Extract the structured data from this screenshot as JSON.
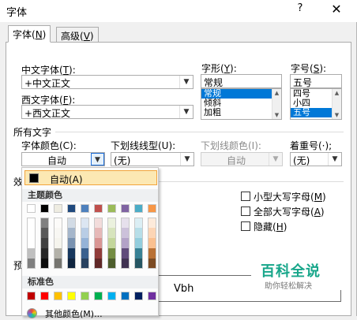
{
  "window": {
    "title": "字体",
    "help_label": "?",
    "close_label": "✕"
  },
  "tabs": [
    {
      "label": "字体(",
      "key": "N",
      "suffix": ")"
    },
    {
      "label": "高级(",
      "key": "V",
      "suffix": ")"
    }
  ],
  "font": {
    "chinese_label": "中文字体(",
    "chinese_key": "T",
    "chinese_suffix": "):",
    "chinese_value": "+中文正文",
    "western_label": "西文字体(",
    "western_key": "F",
    "western_suffix": "):",
    "western_value": "+西文正文",
    "style_label": "字形(",
    "style_key": "Y",
    "style_suffix": "):",
    "style_value": "常规",
    "style_options": [
      "常规",
      "倾斜",
      "加粗"
    ],
    "size_label": "字号(",
    "size_key": "S",
    "size_suffix": "):",
    "size_value": "五号",
    "size_options": [
      "四号",
      "小四",
      "五号"
    ]
  },
  "all_text": {
    "section_label": "所有文字",
    "color_label": "字体颜色(C):",
    "color_value": "自动",
    "underline_label": "下划线线型(U):",
    "underline_value": "(无)",
    "underline_color_label": "下划线颜色(I):",
    "underline_color_value": "自动",
    "emphasis_label": "着重号(·);",
    "emphasis_value": "(无)"
  },
  "effects": {
    "section_label": "效",
    "small_caps": "小型大写字母(",
    "small_caps_key": "M",
    "all_caps": "全部大写字母(",
    "all_caps_key": "A",
    "hidden": "隐藏(",
    "hidden_key": "H",
    "close_paren": ")"
  },
  "preview": {
    "section_label": "预",
    "sample_text": "Vbh"
  },
  "color_popup": {
    "auto_label": "自动(A)",
    "theme_header": "主题颜色",
    "standard_header": "标准色",
    "more_label": "其他颜色(M)...",
    "theme_colors": [
      "#ffffff",
      "#000000",
      "#e7e6e6",
      "#44546a",
      "#4472c4",
      "#ed7d31",
      "#a5a5a5",
      "#ffc000",
      "#5b9bd5",
      "#70ad47"
    ],
    "theme_colors_display": [
      "#ffffff",
      "#000000",
      "#eeece1",
      "#1f497d",
      "#4f81bd",
      "#c0504d",
      "#9bbb59",
      "#8064a2",
      "#4bacc6",
      "#f79646"
    ],
    "standard_colors": [
      "#c00000",
      "#ff0000",
      "#ffc000",
      "#ffff00",
      "#92d050",
      "#00b050",
      "#00b0f0",
      "#0070c0",
      "#002060",
      "#7030a0"
    ]
  },
  "watermark": {
    "main": "百科全说",
    "sub": "助你轻松解决"
  }
}
